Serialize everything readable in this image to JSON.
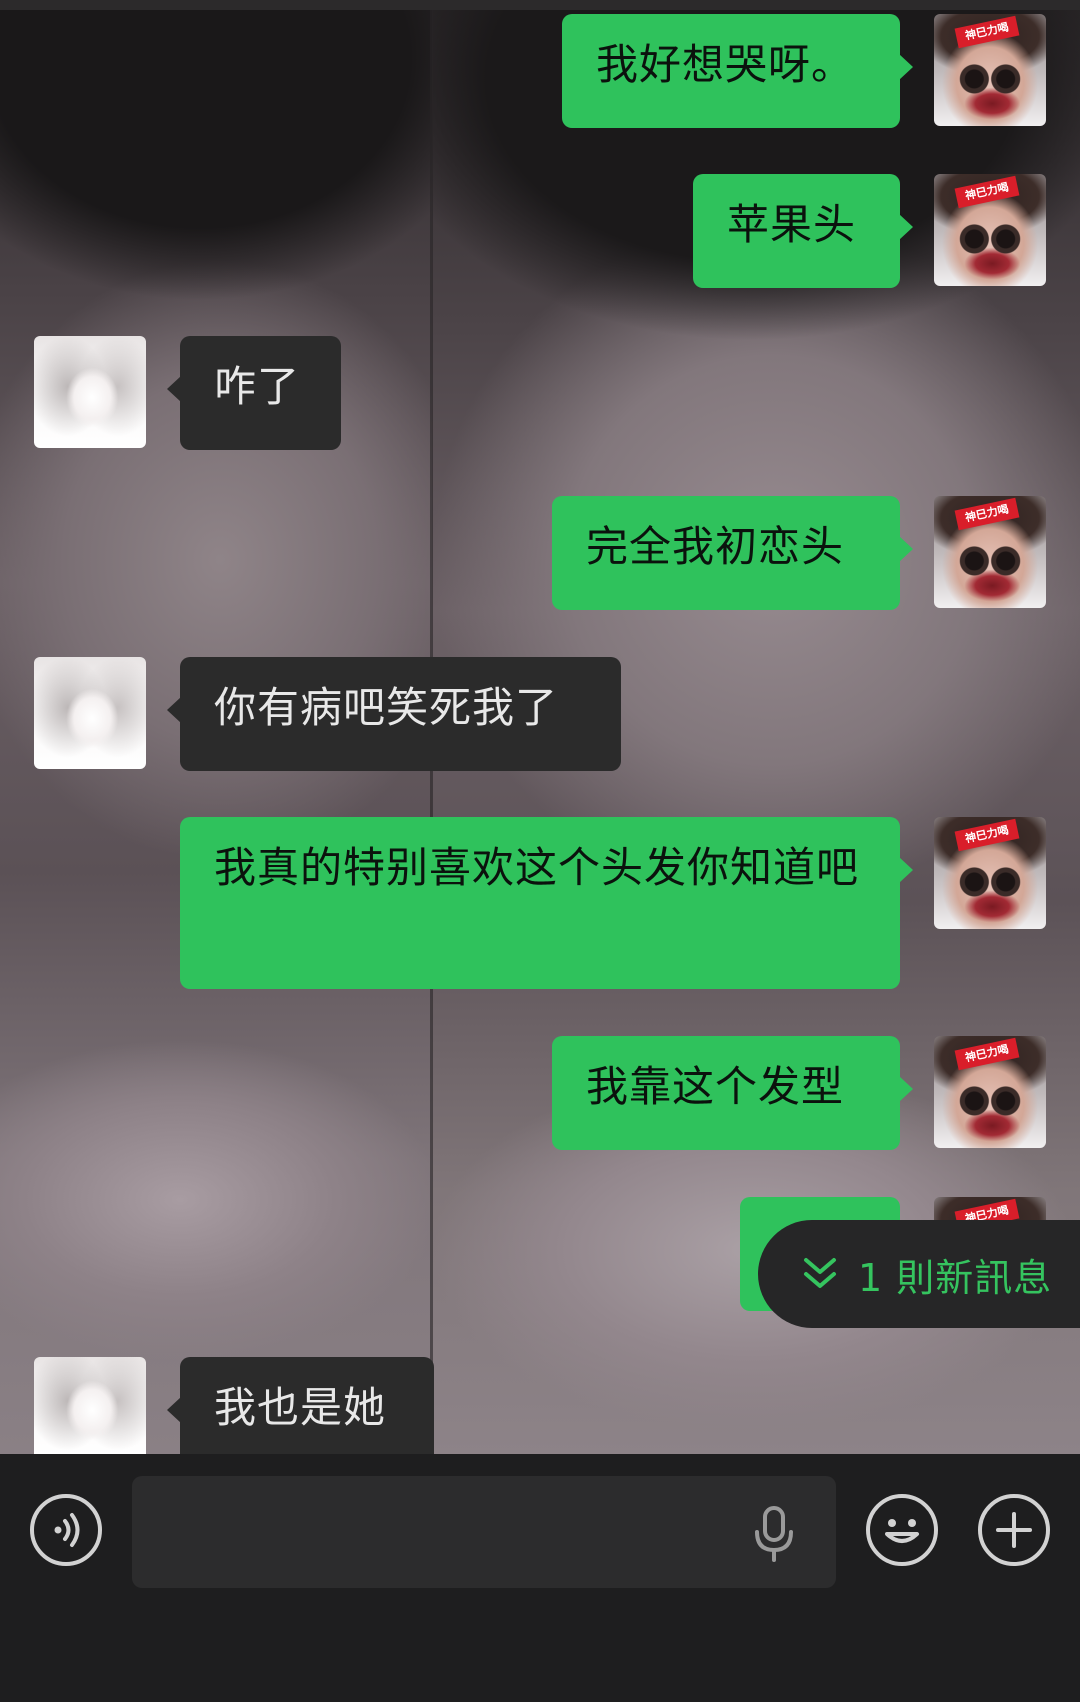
{
  "new_messages": {
    "label": "1 則新訊息",
    "icon": "double-chevron-down-icon"
  },
  "messages": [
    {
      "side": "self",
      "text": "我好想哭呀。"
    },
    {
      "side": "self",
      "text": "苹果头"
    },
    {
      "side": "other",
      "text": "咋了"
    },
    {
      "side": "self",
      "text": "完全我初恋头"
    },
    {
      "side": "other",
      "text": "你有病吧笑死我了"
    },
    {
      "side": "self",
      "text": "我真的特别喜欢这个头发你知道吧"
    },
    {
      "side": "self",
      "text": "我靠这个发型"
    },
    {
      "side": "self",
      "text": ""
    },
    {
      "side": "other",
      "text": "我也是她"
    }
  ],
  "self_avatar_tag": "神巳力喝",
  "input": {
    "value": "",
    "placeholder": ""
  },
  "colors": {
    "self_bubble": "#2fc25c",
    "other_bubble": "#2b2b2b",
    "accent": "#35c45f",
    "input_bar": "#1e1e1f"
  },
  "icons": {
    "voice": "voice-icon",
    "mic": "microphone-icon",
    "emoji": "emoji-icon",
    "plus": "plus-icon"
  }
}
